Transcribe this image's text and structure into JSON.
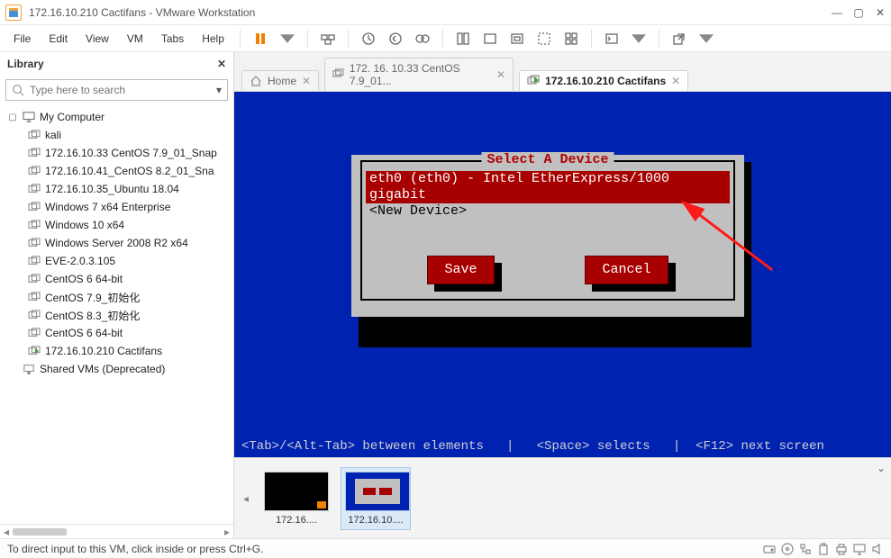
{
  "window": {
    "title": "172.16.10.210 Cactifans - VMware Workstation",
    "controls": {
      "min": "—",
      "max": "▢",
      "close": "✕"
    }
  },
  "menu": {
    "items": [
      "File",
      "Edit",
      "View",
      "VM",
      "Tabs",
      "Help"
    ]
  },
  "library": {
    "title": "Library",
    "close": "✕",
    "search_placeholder": "Type here to search",
    "root": "My Computer",
    "shared": "Shared VMs (Deprecated)",
    "vms": [
      "kali",
      "172.16.10.33 CentOS 7.9_01_Snap",
      "172.16.10.41_CentOS 8.2_01_Sna",
      "172.16.10.35_Ubuntu 18.04",
      "Windows 7 x64 Enterprise",
      "Windows 10 x64",
      "Windows Server 2008 R2 x64",
      "EVE-2.0.3.105",
      "CentOS 6 64-bit",
      "CentOS 7.9_初始化",
      "CentOS 8.3_初始化",
      "CentOS 6 64-bit",
      "172.16.10.210 Cactifans"
    ]
  },
  "tabs": {
    "home": "Home",
    "tab1": "172. 16. 10.33 CentOS 7.9_01...",
    "tab2": "172.16.10.210 Cactifans"
  },
  "tui": {
    "title": "Select A Device",
    "opt_selected": "eth0 (eth0) - Intel EtherExpress/1000 gigabit",
    "opt_new": "<New Device>",
    "save": "Save",
    "cancel": "Cancel",
    "hint": "<Tab>/<Alt-Tab> between elements   |   <Space> selects   |  <F12> next screen"
  },
  "thumbs": {
    "t1": "172.16....",
    "t2": "172.16.10...."
  },
  "status": {
    "hint": "To direct input to this VM, click inside or press Ctrl+G."
  }
}
